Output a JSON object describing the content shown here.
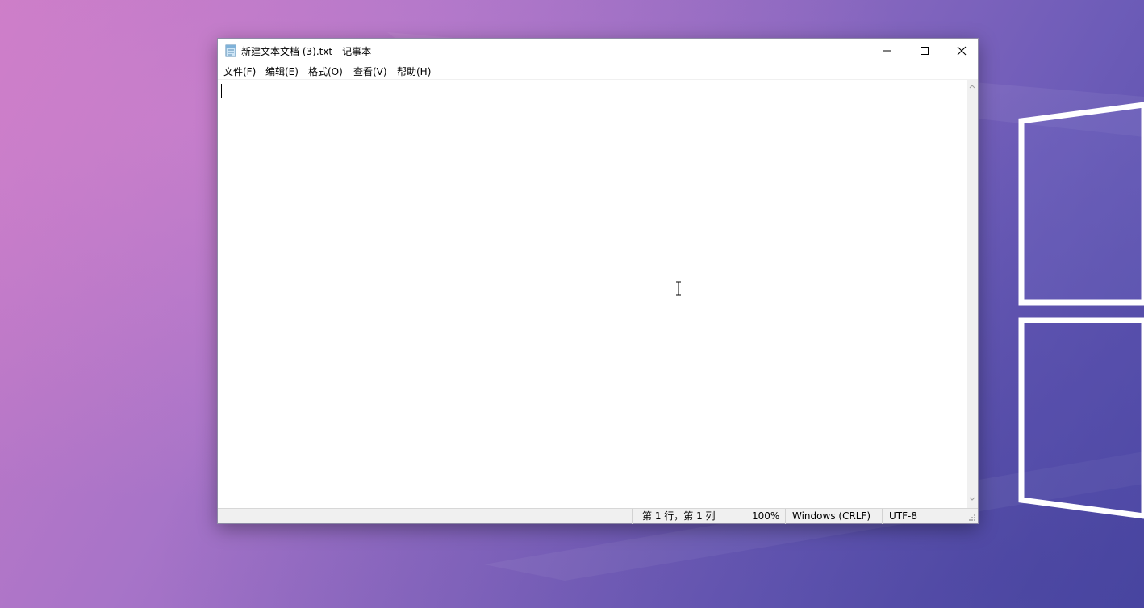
{
  "window": {
    "title": "新建文本文档 (3).txt - 记事本",
    "icon": "notepad-icon",
    "controls": {
      "minimize_icon": "minimize-icon",
      "maximize_icon": "maximize-icon",
      "close_icon": "close-icon"
    }
  },
  "menubar": {
    "items": [
      {
        "label": "文件(F)"
      },
      {
        "label": "编辑(E)"
      },
      {
        "label": "格式(O)"
      },
      {
        "label": "查看(V)"
      },
      {
        "label": "帮助(H)"
      }
    ]
  },
  "editor": {
    "content": ""
  },
  "statusbar": {
    "position": "第 1 行，第 1 列",
    "zoom": "100%",
    "line_ending": "Windows (CRLF)",
    "encoding": "UTF-8"
  },
  "colors": {
    "window_bg": "#ffffff",
    "statusbar_bg": "#f0f0f0",
    "desktop_start": "#c77ac6",
    "desktop_end": "#4f4aa6"
  }
}
